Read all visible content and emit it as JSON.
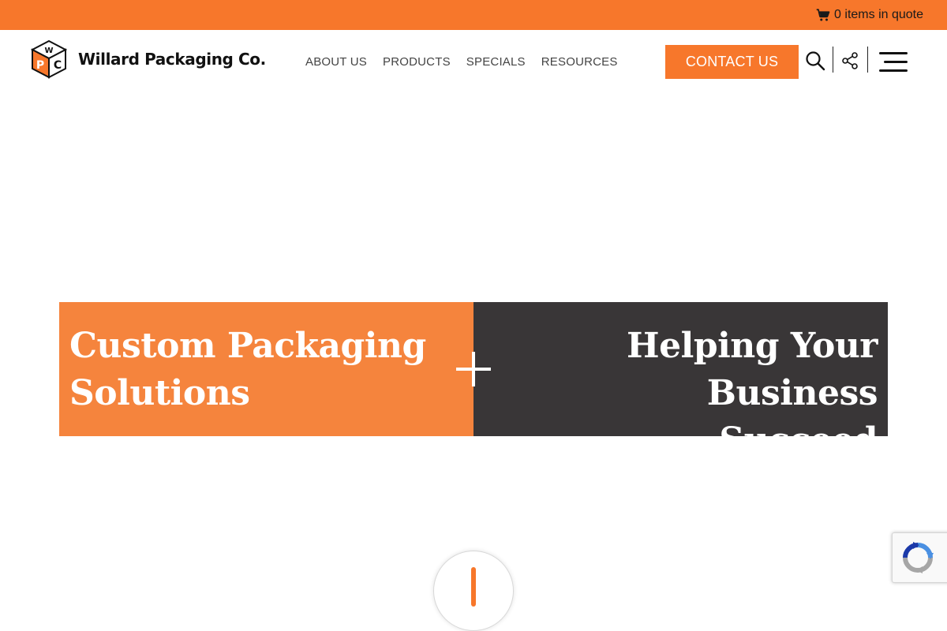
{
  "topbar": {
    "quote_text": "0 items in quote",
    "icon": "cart-icon",
    "background": "#f7772b"
  },
  "brand": {
    "name": "Willard Packaging Co.",
    "logo_letters": [
      "W",
      "P",
      "C"
    ],
    "logo_icon": "cube-logo-icon"
  },
  "nav": {
    "items": [
      {
        "label": "ABOUT US"
      },
      {
        "label": "PRODUCTS"
      },
      {
        "label": "SPECIALS"
      },
      {
        "label": "RESOURCES"
      }
    ]
  },
  "header": {
    "contact_label": "CONTACT US",
    "search_icon": "search-icon",
    "share_icon": "share-icon",
    "menu_icon": "hamburger-menu-icon"
  },
  "hero": {
    "left_line1": "Custom Packaging",
    "left_line2": "Solutions",
    "right_line1": "Helping Your Business",
    "right_line2": "Succeed",
    "left_color": "#f5843d",
    "right_color": "#393637",
    "separator_icon": "plus-icon"
  },
  "widgets": {
    "scroll_icon": "scroll-down-icon",
    "recaptcha_icon": "recaptcha-icon"
  }
}
